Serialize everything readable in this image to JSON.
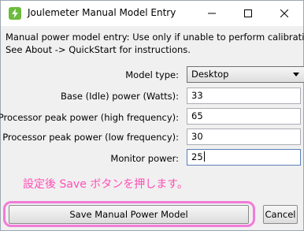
{
  "window": {
    "title": "Joulemeter Manual Model Entry"
  },
  "description": {
    "line1": "Manual power model entry: Use only if unable to perform calibration.",
    "line2": "See About -> QuickStart for instructions."
  },
  "form": {
    "model_type_label": "Model type:",
    "model_type_value": "Desktop",
    "base_power_label": "Base (Idle) power (Watts):",
    "base_power_value": "33",
    "cpu_high_label": "Processor peak power (high frequency):",
    "cpu_high_value": "65",
    "cpu_low_label": "Processor peak power (low frequency):",
    "cpu_low_value": "30",
    "monitor_label": "Monitor power:",
    "monitor_value": "25"
  },
  "annotation": {
    "note": "設定後 Save ボタンを押します。",
    "color": "#ff4fb6"
  },
  "buttons": {
    "save_label": "Save Manual Power Model",
    "cancel_label": "Cancel"
  }
}
